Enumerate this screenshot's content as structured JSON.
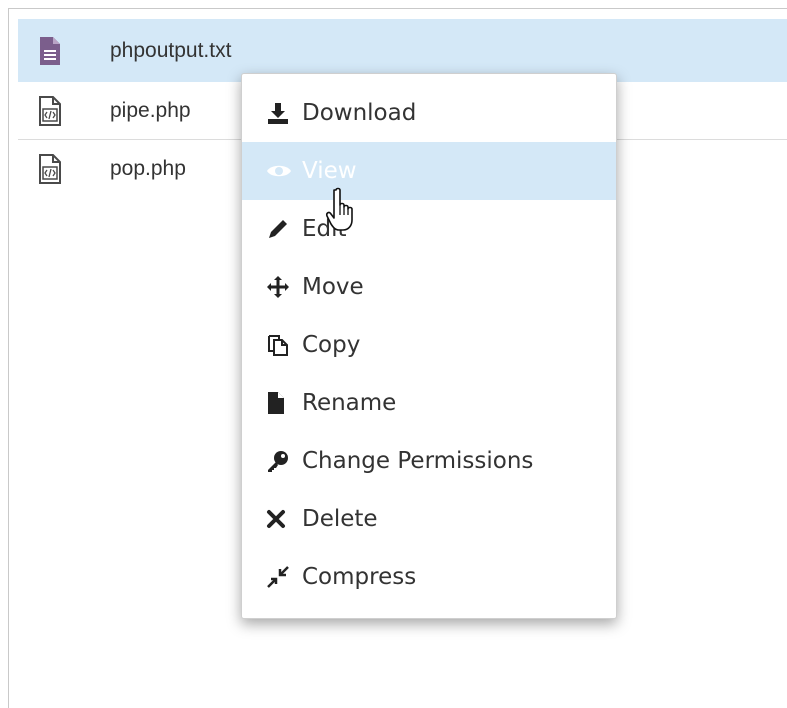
{
  "files": [
    {
      "name": "phpoutput.txt",
      "icon": "text-file-icon",
      "selected": true
    },
    {
      "name": "pipe.php",
      "icon": "code-file-icon",
      "selected": false
    },
    {
      "name": "pop.php",
      "icon": "code-file-icon",
      "selected": false
    }
  ],
  "context_menu": {
    "items": [
      {
        "label": "Download",
        "icon": "download-icon"
      },
      {
        "label": "View",
        "icon": "eye-icon",
        "hovered": true
      },
      {
        "label": "Edit",
        "icon": "pencil-icon"
      },
      {
        "label": "Move",
        "icon": "move-arrows-icon"
      },
      {
        "label": "Copy",
        "icon": "copy-icon"
      },
      {
        "label": "Rename",
        "icon": "file-icon"
      },
      {
        "label": "Change Permissions",
        "icon": "key-icon"
      },
      {
        "label": "Delete",
        "icon": "x-icon"
      },
      {
        "label": "Compress",
        "icon": "compress-icon"
      }
    ]
  },
  "colors": {
    "selection": "#d4e8f7",
    "text_file_icon": "#7b5e8c",
    "code_file_icon": "#4a4a4a",
    "text": "#333333"
  }
}
